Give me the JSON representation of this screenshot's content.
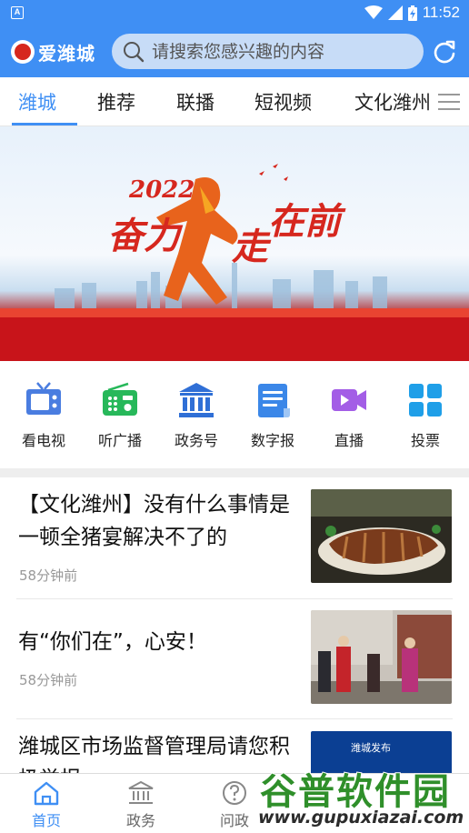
{
  "status_bar": {
    "time": "11:52",
    "app_indicator": "A"
  },
  "header": {
    "logo_text": "爱潍城",
    "search_placeholder": "请搜索您感兴趣的内容",
    "refresh_icon": "refresh-icon"
  },
  "tabs": [
    {
      "label": "潍城",
      "active": true
    },
    {
      "label": "推荐",
      "active": false
    },
    {
      "label": "联播",
      "active": false
    },
    {
      "label": "短视频",
      "active": false
    },
    {
      "label": "文化潍州",
      "active": false
    }
  ],
  "banner": {
    "year_text": "2022",
    "slogan_part1": "奋力",
    "slogan_part2": "走",
    "slogan_part3": "在前"
  },
  "quick_entries": [
    {
      "label": "看电视",
      "icon": "tv-icon"
    },
    {
      "label": "听广播",
      "icon": "radio-icon"
    },
    {
      "label": "政务号",
      "icon": "government-building-icon"
    },
    {
      "label": "数字报",
      "icon": "newspaper-icon"
    },
    {
      "label": "直播",
      "icon": "live-video-icon"
    },
    {
      "label": "投票",
      "icon": "vote-grid-icon"
    }
  ],
  "news": [
    {
      "title": "【文化潍州】没有什么事情是一顿全猪宴解决不了的",
      "time": "58分钟前"
    },
    {
      "title": "有“你们在”，心安！",
      "time": "58分钟前"
    },
    {
      "title": "潍城区市场监督管理局请您积极举报",
      "time": "",
      "thumb_caption": "潍城发布"
    }
  ],
  "bottom_nav": [
    {
      "label": "首页",
      "icon": "home-icon",
      "active": true
    },
    {
      "label": "政务",
      "icon": "government-icon",
      "active": false
    },
    {
      "label": "问政",
      "icon": "question-icon",
      "active": false
    }
  ],
  "watermark": {
    "text": "谷普软件园",
    "url": "www.gupuxiazai.com"
  },
  "colors": {
    "brand_blue": "#3f8ff4",
    "banner_red": "#d6271e"
  }
}
